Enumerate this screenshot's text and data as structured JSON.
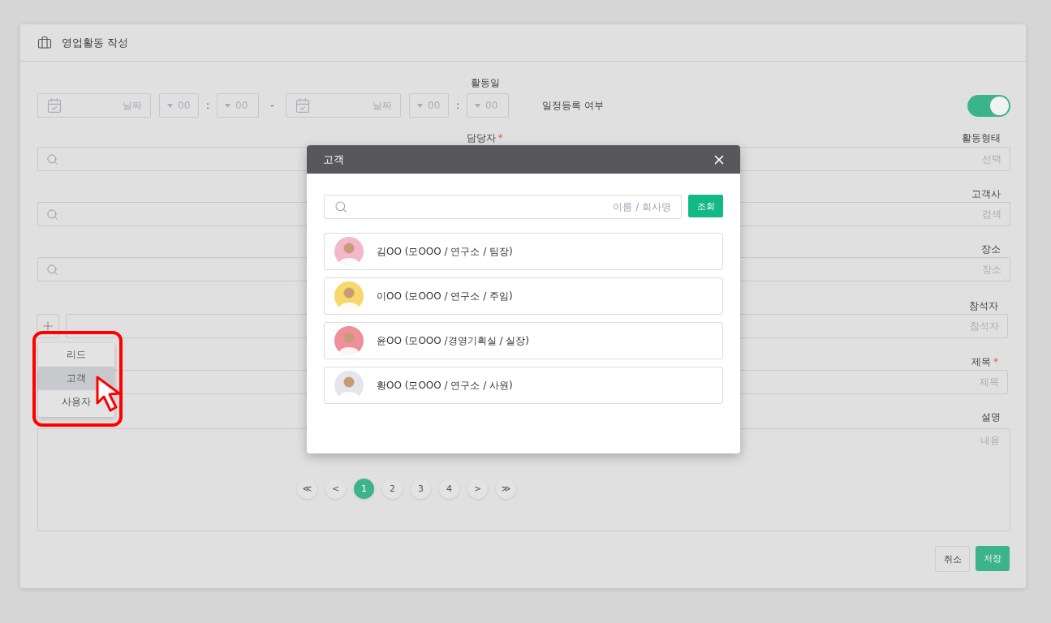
{
  "header": {
    "title": "영업활동 작성"
  },
  "activity_date": {
    "label": "활동일",
    "range_separator": "-",
    "start": {
      "date_placeholder": "날짜",
      "hour": "00",
      "time_separator": ":",
      "minute": "00"
    },
    "end": {
      "date_placeholder": "날짜",
      "hour": "00",
      "time_separator": ":",
      "minute": "00"
    }
  },
  "schedule": {
    "label": "일정등록 여부",
    "on": true
  },
  "manager": {
    "label": "담당자",
    "required_mark": "*"
  },
  "activity_type": {
    "label": "활동형태",
    "placeholder": "선택"
  },
  "customer_company": {
    "label": "고객사",
    "placeholder": "검색"
  },
  "place": {
    "label": "장소",
    "placeholder": "장소"
  },
  "attendees": {
    "label": "참석자",
    "placeholder": "참석자"
  },
  "subject": {
    "label": "제목",
    "required_mark": "*",
    "placeholder": "제목"
  },
  "description": {
    "label": "설명",
    "placeholder": "내용"
  },
  "pagination": [
    {
      "label": "≪",
      "selected": false
    },
    {
      "label": "<",
      "selected": false
    },
    {
      "label": "1",
      "selected": true
    },
    {
      "label": "2",
      "selected": false
    },
    {
      "label": "3",
      "selected": false
    },
    {
      "label": "4",
      "selected": false
    },
    {
      "label": ">",
      "selected": false
    },
    {
      "label": "≫",
      "selected": false
    }
  ],
  "type_menu": [
    {
      "label": "리드",
      "selected": false
    },
    {
      "label": "고객",
      "selected": true
    },
    {
      "label": "사용자",
      "selected": false
    }
  ],
  "buttons": {
    "cancel": "취소",
    "save": "저장"
  },
  "modal": {
    "title": "고객",
    "search_placeholder": "이름 / 회사명",
    "search_button": "조회",
    "customers": [
      {
        "text": "김OO (모OOO / 연구소 / 팀장)",
        "color": "#f2b8cc"
      },
      {
        "text": "이OO (모OOO / 연구소 / 주임)",
        "color": "#f5d96b"
      },
      {
        "text": "윤OO (모OOO /경영기획실 / 실장)",
        "color": "#ee8f9a"
      },
      {
        "text": "황OO (모OOO / 연구소 / 사원)",
        "color": "#e4e6ea"
      }
    ]
  }
}
